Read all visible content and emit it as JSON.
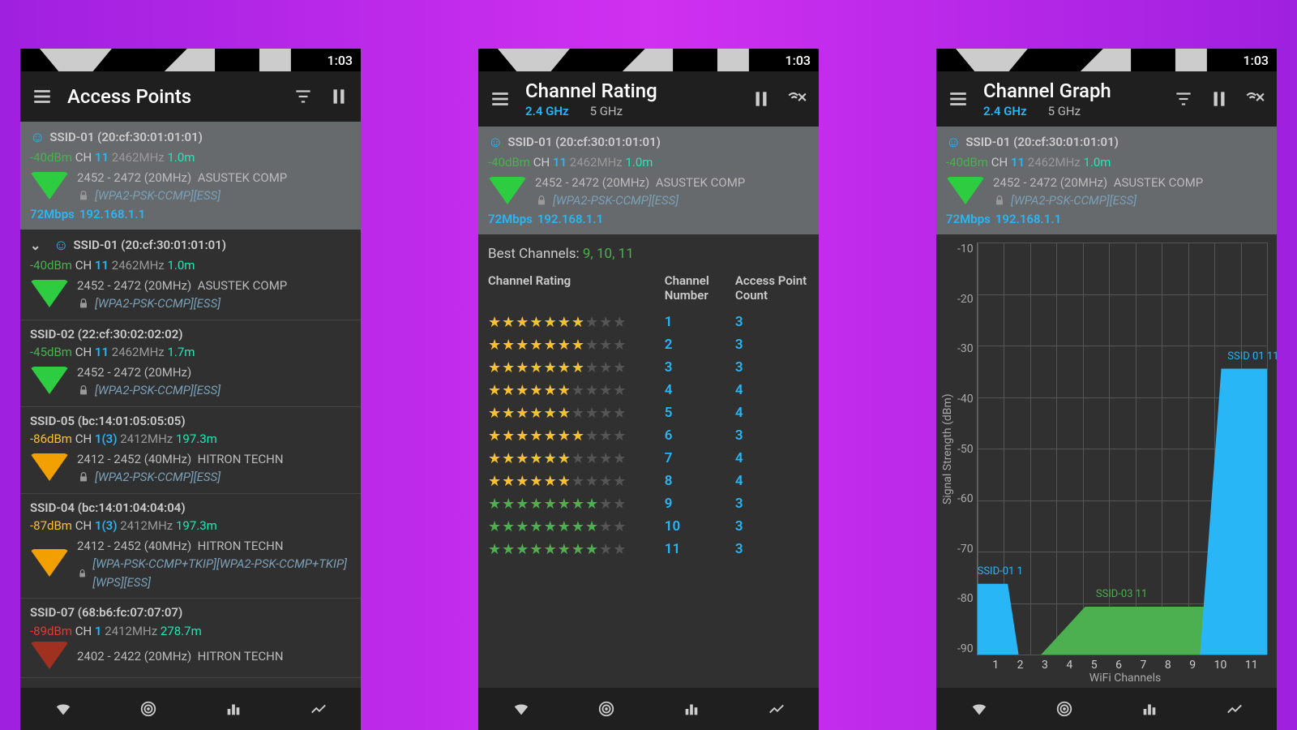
{
  "status": {
    "time": "1:03"
  },
  "screens": {
    "ap": {
      "title": "Access Points"
    },
    "rating": {
      "title": "Channel Rating",
      "band_active": "2.4 GHz",
      "band_inactive": "5 GHz",
      "best_label": "Best Channels: ",
      "best_values": "9, 10, 11",
      "headers": {
        "rating": "Channel Rating",
        "number": "Channel Number",
        "count": "Access Point Count"
      }
    },
    "graph": {
      "title": "Channel Graph",
      "band_active": "2.4 GHz",
      "band_inactive": "5 GHz",
      "ylabel": "Signal Strength (dBm)",
      "xlabel": "WiFi Channels"
    }
  },
  "connected_ap": {
    "ssid_mac": "SSID-01 (20:cf:30:01:01:01)",
    "dbm": "-40dBm",
    "ch_label": "CH",
    "ch": "11",
    "freq": "2462MHz",
    "dist": "1.0m",
    "range": "2452 - 2472 (20MHz)",
    "vendor": "ASUSTEK COMP",
    "security": "[WPA2-PSK-CCMP][ESS]",
    "mbps": "72Mbps",
    "ip": "192.168.1.1"
  },
  "ap_list": [
    {
      "ssid_mac": "SSID-01 (20:cf:30:01:01:01)",
      "dbm": "-40dBm",
      "dbm_class": "green",
      "ch": "11",
      "freq": "2462MHz",
      "dist": "1.0m",
      "range": "2452 - 2472 (20MHz)",
      "vendor": "ASUSTEK COMP",
      "security": "[WPA2-PSK-CCMP][ESS]",
      "tri": "green",
      "chevron": true,
      "smiley": true
    },
    {
      "ssid_mac": "SSID-02 (22:cf:30:02:02:02)",
      "dbm": "-45dBm",
      "dbm_class": "green",
      "ch": "11",
      "freq": "2462MHz",
      "dist": "1.7m",
      "range": "2452 - 2472 (20MHz)",
      "vendor": "",
      "security": "[WPA2-PSK-CCMP][ESS]",
      "tri": "green"
    },
    {
      "ssid_mac": "SSID-05 (bc:14:01:05:05:05)",
      "dbm": "-86dBm",
      "dbm_class": "yellow",
      "ch": "1(3)",
      "freq": "2412MHz",
      "dist": "197.3m",
      "range": "2412 - 2452 (40MHz)",
      "vendor": "HITRON TECHN",
      "security": "[WPA2-PSK-CCMP][ESS]",
      "tri": "yellow"
    },
    {
      "ssid_mac": "SSID-04 (bc:14:01:04:04:04)",
      "dbm": "-87dBm",
      "dbm_class": "yellow",
      "ch": "1(3)",
      "freq": "2412MHz",
      "dist": "197.3m",
      "range": "2412 - 2452 (40MHz)",
      "vendor": "HITRON TECHN",
      "security": "[WPA-PSK-CCMP+TKIP][WPA2-PSK-CCMP+TKIP][WPS][ESS]",
      "tri": "yellow"
    },
    {
      "ssid_mac": "SSID-07 (68:b6:fc:07:07:07)",
      "dbm": "-89dBm",
      "dbm_class": "red",
      "ch": "1",
      "freq": "2412MHz",
      "dist": "278.7m",
      "range": "2402 - 2422 (20MHz)",
      "vendor": "HITRON TECHN",
      "security": "",
      "tri": "red"
    }
  ],
  "rating_rows": [
    {
      "stars": 7.5,
      "color": "y",
      "num": "1",
      "count": "3"
    },
    {
      "stars": 7.5,
      "color": "y",
      "num": "2",
      "count": "3"
    },
    {
      "stars": 7.5,
      "color": "y",
      "num": "3",
      "count": "3"
    },
    {
      "stars": 6.5,
      "color": "y",
      "num": "4",
      "count": "4"
    },
    {
      "stars": 6.5,
      "color": "y",
      "num": "5",
      "count": "4"
    },
    {
      "stars": 7.5,
      "color": "y",
      "num": "6",
      "count": "3"
    },
    {
      "stars": 6.5,
      "color": "y",
      "num": "7",
      "count": "4"
    },
    {
      "stars": 6.5,
      "color": "y",
      "num": "8",
      "count": "4"
    },
    {
      "stars": 8,
      "color": "g",
      "num": "9",
      "count": "3"
    },
    {
      "stars": 8,
      "color": "g",
      "num": "10",
      "count": "3"
    },
    {
      "stars": 8,
      "color": "g",
      "num": "11",
      "count": "3"
    }
  ],
  "chart_data": {
    "type": "area",
    "title": "Channel Graph",
    "xlabel": "WiFi Channels",
    "ylabel": "Signal Strength (dBm)",
    "ylim": [
      -100,
      -10
    ],
    "yticks": [
      -10,
      -20,
      -30,
      -40,
      -50,
      -60,
      -70,
      -80,
      -90
    ],
    "x_channels": [
      1,
      2,
      3,
      4,
      5,
      6,
      7,
      8,
      9,
      10,
      11
    ],
    "series": [
      {
        "name": "SSID-01 1",
        "channel": 1,
        "peak_dbm": -85,
        "half_width_channels": 1,
        "color": "#29b6f6"
      },
      {
        "name": "SSID-03 11",
        "channel": 7,
        "peak_dbm": -90,
        "half_width_channels": 4,
        "color": "#4caf50"
      },
      {
        "name": "SSID 01 11",
        "channel": 11,
        "peak_dbm": -38,
        "half_width_channels": 2,
        "color": "#29b6f6"
      }
    ]
  },
  "bottom_nav": {
    "items": [
      "Access Points",
      "Channel Rating",
      "Channel Graph",
      "Time Graph"
    ]
  }
}
